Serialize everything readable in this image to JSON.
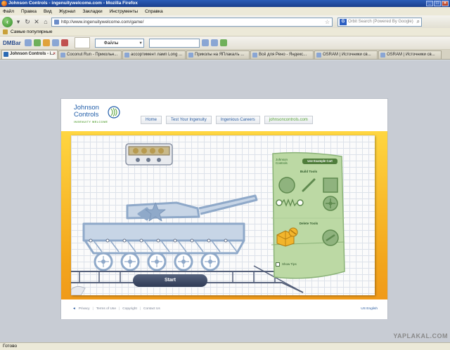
{
  "window": {
    "title": "Johnson Controls - ingenuitywelcome.com - Mozilla Firefox"
  },
  "menu": [
    "Файл",
    "Правка",
    "Вид",
    "Журнал",
    "Закладки",
    "Инструменты",
    "Справка"
  ],
  "nav": {
    "url": "http://www.ingenuitywelcome.com/game/",
    "search_placeholder": "Orbit Search (Powered By Google)"
  },
  "bookmarks": {
    "label": "Самые популярные"
  },
  "toolbar": {
    "brand": "DMBar",
    "select_value": "Файлы"
  },
  "tabs": [
    {
      "label": "Johnson Controls - i...",
      "active": true
    },
    {
      "label": "Coconut Run - Прикольн...",
      "active": false
    },
    {
      "label": "ассортимент ламп Long ...",
      "active": false
    },
    {
      "label": "Приколы на ЯПлакалъ ...",
      "active": false
    },
    {
      "label": "Всё для Рено - Яндекс...",
      "active": false
    },
    {
      "label": "OSRAM | Источники св...",
      "active": false
    },
    {
      "label": "OSRAM | Источники св...",
      "active": false
    }
  ],
  "site": {
    "logo_line1": "Johnson",
    "logo_line2": "Controls",
    "logo_tag": "INGENUITY WELCOME",
    "nav": [
      "Home",
      "Test Your Ingenuity",
      "Ingenious Careers",
      "johnsoncontrols.com"
    ]
  },
  "game": {
    "start_label": "Start",
    "panel_brand_line1": "Johnson",
    "panel_brand_line2": "Controls",
    "example_label": "Use Example Cart",
    "build_tools_label": "Build Tools",
    "delete_tools_label": "Delete Tools",
    "show_tips_label": "Show Tips"
  },
  "footer": {
    "links": [
      "Privacy",
      "Terms of Use",
      "Copyright",
      "Contact Us"
    ],
    "language": "US English"
  },
  "status": {
    "text": "Готово"
  },
  "watermark": "YAPLAKAL.COM",
  "colors": {
    "brand_blue": "#1f5ca8",
    "brand_green": "#5aa33a",
    "stage_yellow": "#ffd640",
    "panel_green": "#bcd9a4"
  }
}
